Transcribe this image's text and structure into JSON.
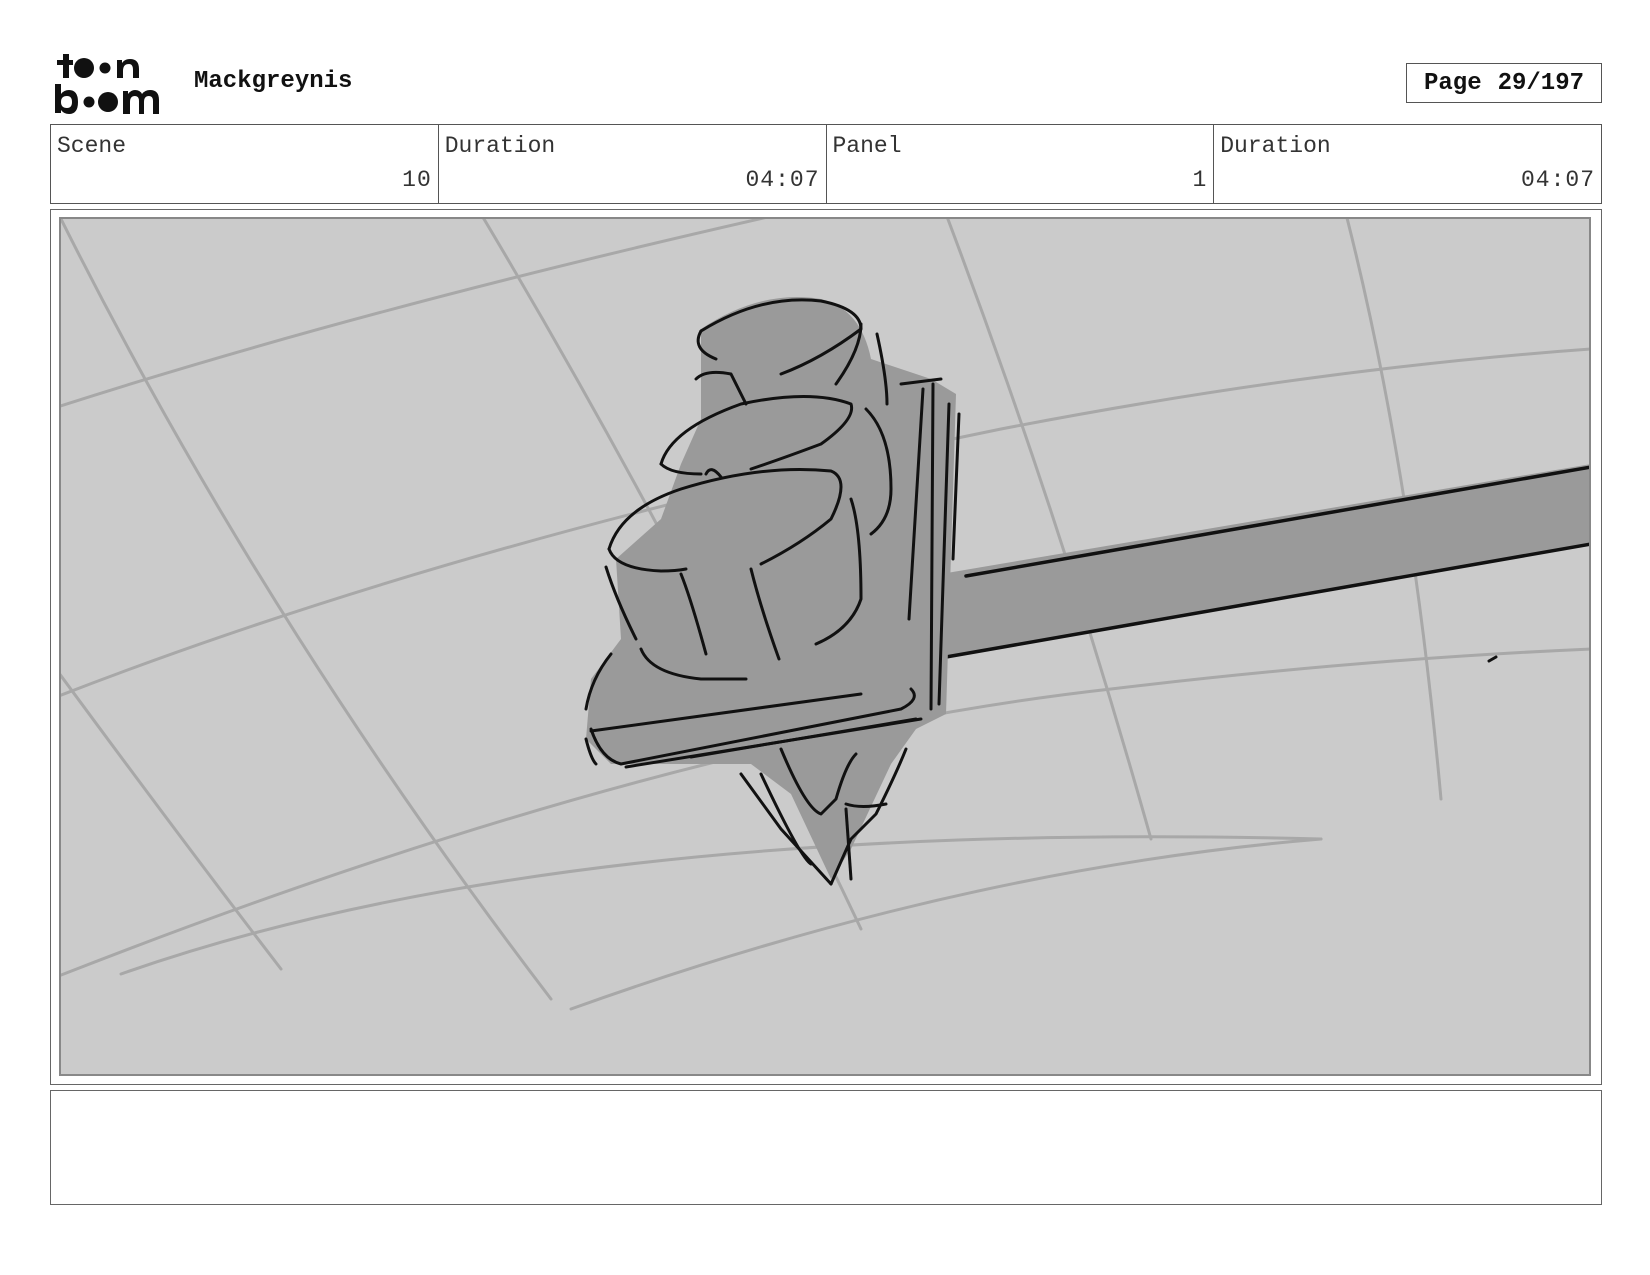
{
  "header": {
    "logo_text": "toon boom",
    "project_title": "Mackgreynis",
    "page_label": "Page",
    "page_number": "29/197"
  },
  "info": {
    "scene_label": "Scene",
    "scene_value": "10",
    "scene_duration_label": "Duration",
    "scene_duration_value": "04:07",
    "panel_label": "Panel",
    "panel_value": "1",
    "panel_duration_label": "Duration",
    "panel_duration_value": "04:07"
  },
  "notes": {
    "text": ""
  }
}
